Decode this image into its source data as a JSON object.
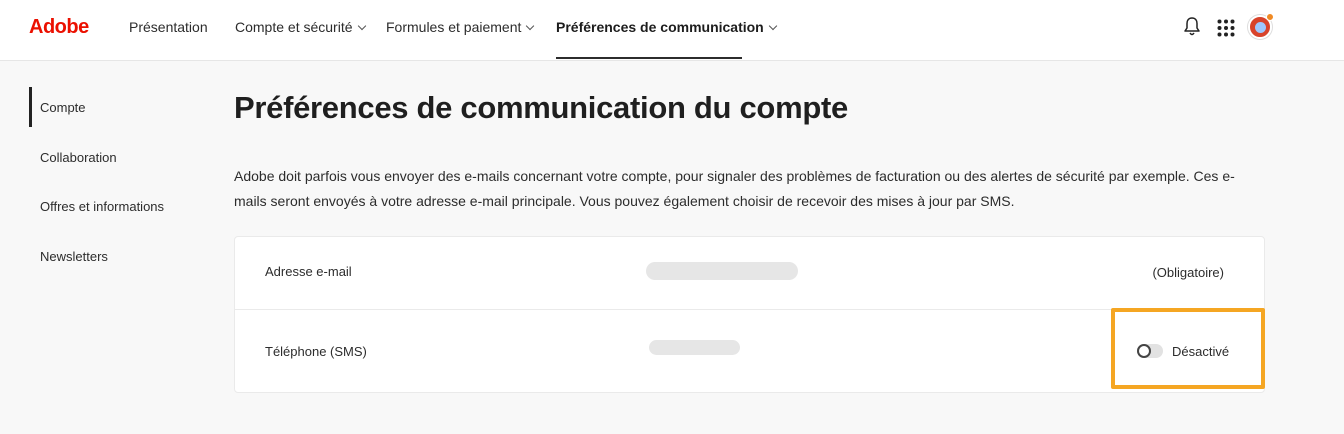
{
  "brand": {
    "logo_text": "Adobe",
    "color": "#eb1000"
  },
  "nav": {
    "items": [
      {
        "label": "Présentation",
        "has_menu": false
      },
      {
        "label": "Compte et sécurité",
        "has_menu": true
      },
      {
        "label": "Formules et paiement",
        "has_menu": true
      },
      {
        "label": "Préférences de communication",
        "has_menu": true,
        "active": true
      }
    ],
    "icons": [
      "bell-icon",
      "apps-grid-icon",
      "avatar"
    ]
  },
  "sidebar": {
    "items": [
      {
        "label": "Compte",
        "active": true
      },
      {
        "label": "Collaboration"
      },
      {
        "label": "Offres et informations"
      },
      {
        "label": "Newsletters"
      }
    ]
  },
  "main": {
    "title": "Préférences de communication du compte",
    "description": "Adobe doit parfois vous envoyer des e-mails concernant votre compte, pour signaler des problèmes de facturation ou des alertes de sécurité par exemple. Ces e-mails seront envoyés à votre adresse e-mail principale. Vous pouvez également choisir de recevoir des mises à jour par SMS.",
    "rows": [
      {
        "label": "Adresse e-mail",
        "status": "(Obligatoire)"
      },
      {
        "label": "Téléphone (SMS)",
        "toggle_state": "Désactivé",
        "toggle_on": false
      }
    ]
  },
  "highlight_color": "#f5a623"
}
